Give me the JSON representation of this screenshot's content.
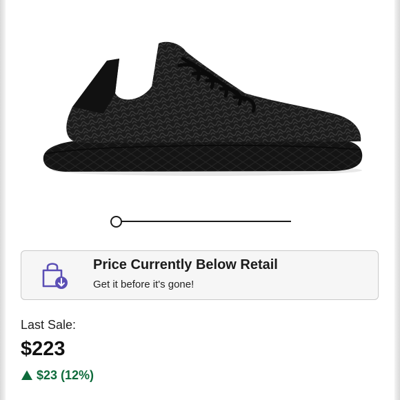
{
  "product": {
    "image_alt": "black mesh sneaker"
  },
  "banner": {
    "title": "Price Currently Below Retail",
    "subtitle": "Get it before it's gone!",
    "icon": "shopping-bag-arrow-icon",
    "icon_color": "#5b4fb5"
  },
  "slider": {
    "position_fraction": 0
  },
  "sale": {
    "label": "Last Sale:",
    "price": "$223",
    "change": "$23 (12%)",
    "change_direction": "up",
    "change_color": "#0e6b3b"
  }
}
